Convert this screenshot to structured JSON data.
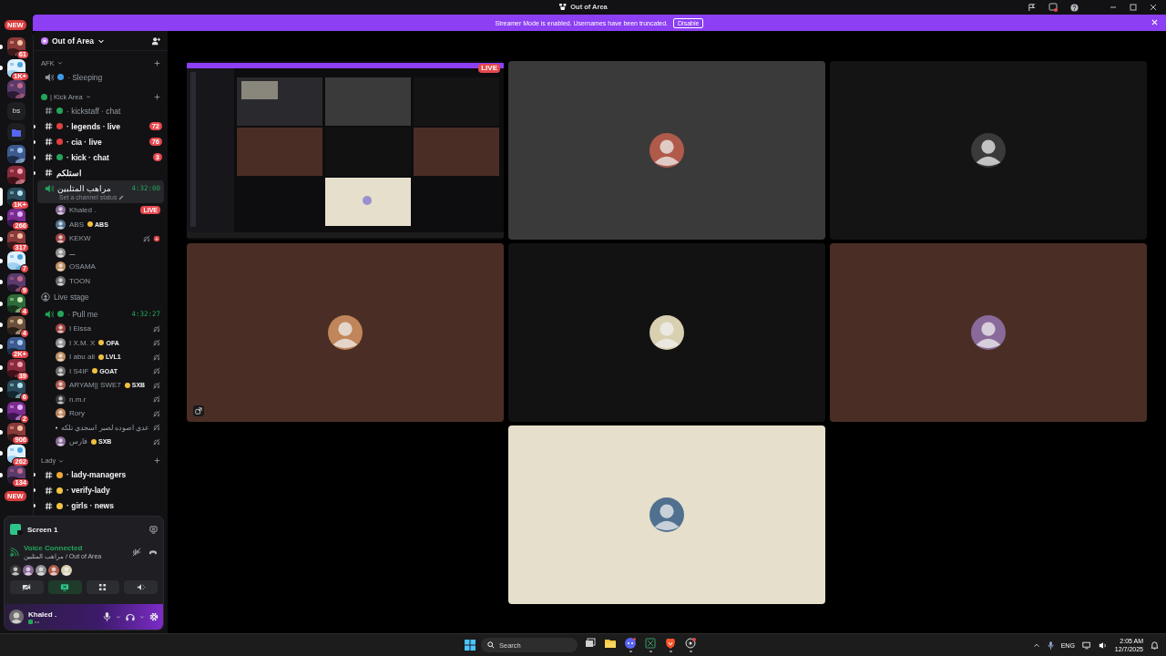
{
  "window": {
    "title": "Out of Area"
  },
  "banner": {
    "message": "Streamer Mode is enabled. Usernames have been truncated.",
    "button": "Disable"
  },
  "servers": [
    {
      "kind": "new",
      "label": "NEW"
    },
    {
      "kind": "picture",
      "badge": "61",
      "unread": true,
      "selected": false
    },
    {
      "kind": "picture",
      "badge": "1K+",
      "unread": true,
      "selected": false
    },
    {
      "kind": "picture",
      "unread": false,
      "selected": false
    },
    {
      "kind": "text",
      "label": "bs",
      "unread": false,
      "selected": false
    },
    {
      "kind": "folder",
      "unread": false,
      "selected": false
    },
    {
      "kind": "picture",
      "unread": false,
      "selected": false
    },
    {
      "kind": "picture",
      "unread": false,
      "selected": false
    },
    {
      "kind": "picture",
      "badge": "1K+",
      "unread": false,
      "selected": true
    },
    {
      "kind": "picture",
      "badge": "266",
      "unread": true,
      "selected": false
    },
    {
      "kind": "picture",
      "badge": "317",
      "unread": true,
      "selected": false
    },
    {
      "kind": "picture",
      "badge": "7",
      "unread": true,
      "selected": false
    },
    {
      "kind": "picture",
      "badge": "9",
      "unread": true,
      "selected": false
    },
    {
      "kind": "picture",
      "badge": "4",
      "unread": true,
      "selected": false
    },
    {
      "kind": "picture",
      "badge": "4",
      "unread": true,
      "selected": false
    },
    {
      "kind": "picture",
      "badge": "2K+",
      "unread": true,
      "selected": false
    },
    {
      "kind": "picture",
      "badge": "39",
      "unread": true,
      "selected": false
    },
    {
      "kind": "picture",
      "badge": "6",
      "unread": true,
      "selected": false
    },
    {
      "kind": "picture",
      "badge": "2",
      "unread": true,
      "selected": false
    },
    {
      "kind": "picture",
      "badge": "906",
      "unread": true,
      "selected": false
    },
    {
      "kind": "picture",
      "badge": "262",
      "unread": true,
      "selected": false
    },
    {
      "kind": "picture",
      "badge": "134",
      "unread": true,
      "selected": false
    },
    {
      "kind": "new",
      "label": "NEW"
    }
  ],
  "sidebar": {
    "server": {
      "name": "Out of Area"
    },
    "categories": [
      {
        "name": "AFK",
        "expanded": true,
        "channels": [
          {
            "kind": "voice",
            "name": "· Sleeping",
            "color": "#3f9ae8",
            "selected": false
          }
        ]
      },
      {
        "name": "| Kick Area",
        "color": "#23a55a",
        "expanded": true,
        "channels": [
          {
            "kind": "text",
            "name": "· kickstaff · chat",
            "color": "#23a55a",
            "unread": false
          },
          {
            "kind": "text",
            "name": "· legends · live",
            "color": "#e0413f",
            "unread": true,
            "badge": "72"
          },
          {
            "kind": "text",
            "name": "· cia · live",
            "color": "#e0413f",
            "unread": true,
            "badge": "76"
          },
          {
            "kind": "text",
            "name": "· kick · chat",
            "color": "#23a55a",
            "unread": true,
            "badge": "3"
          },
          {
            "kind": "text",
            "name": "استلكم",
            "unread": true
          },
          {
            "kind": "voice",
            "name": "مراهب المتلبين",
            "selected": true,
            "timer": "4:32:00",
            "status": "Set a channel status",
            "users": [
              {
                "name": "Khaled .",
                "badge": "LIVE",
                "deafened": false,
                "muted": false
              },
              {
                "name": "ABS",
                "tag": "ABS",
                "deafened": false,
                "muted": false
              },
              {
                "name": "KEKW",
                "deafened": true,
                "muted": true
              },
              {
                "name": "ـــ",
                "deafened": false,
                "muted": false
              },
              {
                "name": "OSAMA",
                "deafened": false,
                "muted": false
              },
              {
                "name": "TOON",
                "deafened": false,
                "muted": false
              }
            ]
          },
          {
            "kind": "stage",
            "name": "Live stage"
          },
          {
            "kind": "voice",
            "name": "· Pull me",
            "color": "#23a55a",
            "selected": false,
            "timer": "4:32:27",
            "users": [
              {
                "name": "I Eissa",
                "deafened": true,
                "muted": false
              },
              {
                "name": "I X.M. X",
                "tag": "OFA",
                "deafened": true,
                "muted": false
              },
              {
                "name": "I abu ali",
                "tag": "LVL1",
                "deafened": true,
                "muted": false
              },
              {
                "name": "I S4IF",
                "tag": "GOAT",
                "deafened": true,
                "muted": false
              },
              {
                "name": "ARYAM|| SWE7",
                "tag": "SXB",
                "deafened": true,
                "muted": false
              },
              {
                "name": "n.m.r",
                "deafened": true,
                "muted": false
              },
              {
                "name": "Rory",
                "deafened": true,
                "muted": false
              },
              {
                "name": "عدي اصوده لصبر اسجدي تلكه",
                "deafened": true,
                "muted": false
              },
              {
                "name": "فارس",
                "tag": "SXB",
                "deafened": true,
                "muted": false
              }
            ]
          }
        ]
      },
      {
        "name": "Lady",
        "expanded": true,
        "channels": [
          {
            "kind": "text",
            "name": "· lady-managers",
            "color": "#f0a732",
            "unread": true
          },
          {
            "kind": "text",
            "name": "· verify-lady",
            "color": "#f5c542",
            "unread": true
          },
          {
            "kind": "text",
            "name": "· girls · news",
            "color": "#f5c542",
            "unread": true
          }
        ]
      }
    ]
  },
  "panel": {
    "stream": {
      "title": "Screen 1"
    },
    "voice": {
      "status": "Voice Connected",
      "location": "مراهب المتلبين / Out of Area"
    },
    "actions": [
      {
        "kind": "camera",
        "on": false
      },
      {
        "kind": "screen",
        "on": true
      },
      {
        "kind": "activity",
        "on": false
      },
      {
        "kind": "soundboard",
        "on": false
      }
    ],
    "user": {
      "name": "Khaled .",
      "muted": false,
      "deafened": false
    }
  },
  "tiles": [
    {
      "kind": "screen",
      "badge": "LIVE"
    },
    {
      "kind": "avatar",
      "color": "#3a3a3a"
    },
    {
      "kind": "avatar",
      "color": "#141414"
    },
    {
      "kind": "avatar",
      "color": "#4a2e25",
      "popout": true
    },
    {
      "kind": "avatar",
      "color": "#121212"
    },
    {
      "kind": "avatar",
      "color": "#4a2e25"
    },
    {
      "kind": "avatar",
      "color": "#e6dfcb"
    }
  ],
  "taskbar": {
    "search": {
      "placeholder": "Search"
    },
    "apps": [
      {
        "kind": "taskview",
        "running": false
      },
      {
        "kind": "explorer",
        "running": false
      },
      {
        "kind": "discord",
        "running": true
      },
      {
        "kind": "sheet",
        "running": true
      },
      {
        "kind": "browser",
        "running": true
      },
      {
        "kind": "recorder",
        "running": true
      }
    ],
    "language": "ENG",
    "time": "2:05 AM",
    "date": "12/7/2025"
  }
}
